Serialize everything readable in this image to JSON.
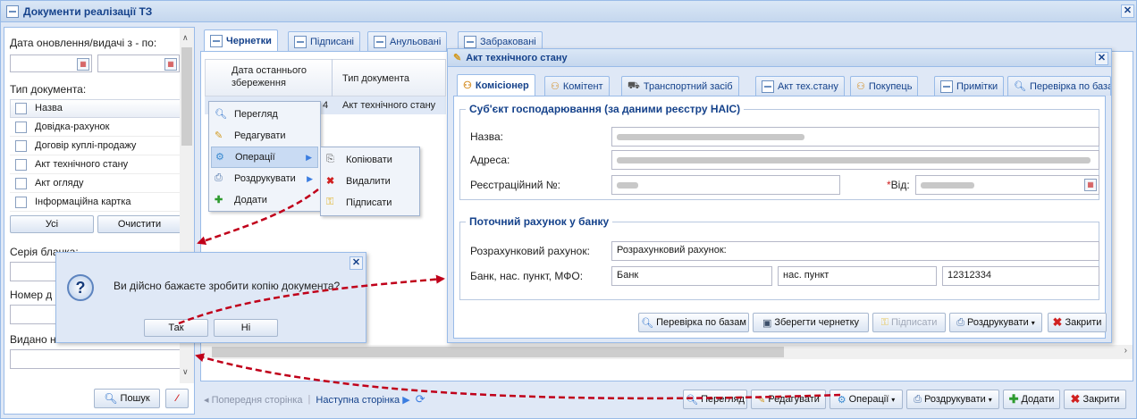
{
  "main_window": {
    "title": "Документи реалізації ТЗ"
  },
  "filter": {
    "date_label": "Дата оновлення/видачі з - по:",
    "doc_type_label": "Тип документа:",
    "table_header": "Назва",
    "doc_types": [
      "Довідка-рахунок",
      "Договір куплі-продажу",
      "Акт технічного стану",
      "Акт огляду",
      "Інформаційна картка"
    ],
    "all_button": "Усі",
    "clear_button": "Очистити",
    "series_label": "Серія бланка:",
    "number_label": "Номер д",
    "issued_label": "Видано н",
    "search_button": "Пошук"
  },
  "doc_tabs": [
    "Чернетки",
    "Підписані",
    "Анульовані",
    "Забраковані"
  ],
  "grid": {
    "col_date": "Дата останнього збереження",
    "col_type": "Тип документа",
    "row_date_fragment": "4",
    "row_type": "Акт технічного стану"
  },
  "context_menu": {
    "items": [
      "Перегляд",
      "Редагувати",
      "Операції",
      "Роздрукувати",
      "Додати"
    ],
    "submenu": [
      "Копіювати",
      "Видалити",
      "Підписати"
    ]
  },
  "confirm_dialog": {
    "message": "Ви дійсно бажаєте зробити копію документа?",
    "yes": "Так",
    "no": "Ні"
  },
  "pager": {
    "prev": "Попередня сторінка",
    "next": "Наступна сторінка"
  },
  "bottom_toolbar": {
    "view": "Перегляд",
    "edit": "Редагувати",
    "operations": "Операції",
    "print": "Роздрукувати",
    "add": "Додати",
    "close": "Закрити"
  },
  "act_window": {
    "title": "Акт технічного стану",
    "tabs": [
      "Комісіонер",
      "Комітент",
      "Транспортний засіб",
      "Акт тех.стану",
      "Покупець",
      "Примітки",
      "Перевірка по базам"
    ],
    "entity_legend": "Суб'єкт господарювання (за даними реєстру НАІС)",
    "name_label": "Назва:",
    "address_label": "Адреса:",
    "reg_label": "Реєстраційний №:",
    "from_label": "Від:",
    "account_legend": "Поточний рахунок у банку",
    "account_label": "Розрахунковий рахунок:",
    "account_value": "Розрахунковий рахунок:",
    "bank_label": "Банк, нас. пункт, МФО:",
    "bank_value": "Банк",
    "city_value": "нас. пункт",
    "mfo_value": "12312334",
    "buttons": {
      "check": "Перевірка по базам",
      "save": "Зберегти чернетку",
      "sign": "Підписати",
      "print": "Роздрукувати",
      "close": "Закрити"
    }
  },
  "colors": {
    "title_text": "#15428b",
    "border": "#99bbe8",
    "arrow": "#c0001a"
  }
}
